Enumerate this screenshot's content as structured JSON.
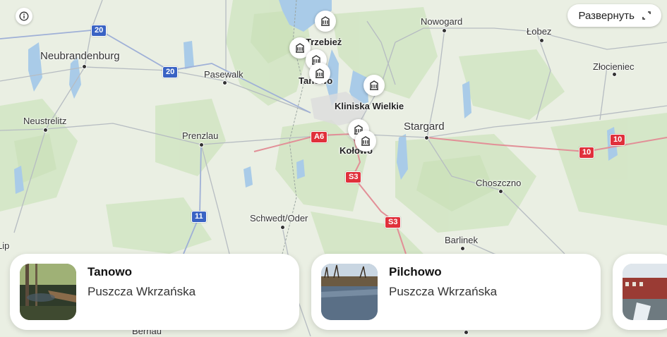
{
  "map": {
    "places": [
      {
        "key": "neubrandenburg",
        "name": "Neubrandenburg"
      },
      {
        "key": "pasewalk",
        "name": "Pasewalk"
      },
      {
        "key": "neustrelitz",
        "name": "Neustrelitz"
      },
      {
        "key": "prenzlau",
        "name": "Prenzlau"
      },
      {
        "key": "schwedt",
        "name": "Schwedt/Oder"
      },
      {
        "key": "trzebiez",
        "name": "Trzebież"
      },
      {
        "key": "tanowo",
        "name": "Tanowo"
      },
      {
        "key": "kliniska",
        "name": "Kliniska Wielkie"
      },
      {
        "key": "kolowo",
        "name": "Kołowo"
      },
      {
        "key": "stargard",
        "name": "Stargard"
      },
      {
        "key": "nowogard",
        "name": "Nowogard"
      },
      {
        "key": "lobez",
        "name": "Łobez"
      },
      {
        "key": "zlocieniec",
        "name": "Złocieniec"
      },
      {
        "key": "choszczno",
        "name": "Choszczno"
      },
      {
        "key": "barlinek",
        "name": "Barlinek"
      },
      {
        "key": "lippi",
        "name": "Lippi"
      },
      {
        "key": "bernau",
        "name": "Bernau"
      }
    ],
    "road_shields": [
      {
        "key": "20a",
        "label": "20",
        "color": "blue"
      },
      {
        "key": "20b",
        "label": "20",
        "color": "blue"
      },
      {
        "key": "11",
        "label": "11",
        "color": "blue"
      },
      {
        "key": "a6",
        "label": "A6",
        "color": "red"
      },
      {
        "key": "s3a",
        "label": "S3",
        "color": "red"
      },
      {
        "key": "s3b",
        "label": "S3",
        "color": "red"
      },
      {
        "key": "10a",
        "label": "10",
        "color": "red"
      },
      {
        "key": "10b",
        "label": "10",
        "color": "red"
      }
    ],
    "pins": [
      "museum-pin",
      "museum-pin",
      "museum-pin",
      "museum-pin",
      "museum-pin",
      "museum-pin",
      "museum-pin"
    ]
  },
  "controls": {
    "info_icon": "info-icon",
    "expand_label": "Развернуть",
    "expand_icon": "expand-icon"
  },
  "cards": [
    {
      "title": "Tanowo",
      "subtitle": "Puszcza Wkrzańska"
    },
    {
      "title": "Pilchowo",
      "subtitle": "Puszcza Wkrzańska"
    },
    {
      "title": "",
      "subtitle": ""
    }
  ]
}
